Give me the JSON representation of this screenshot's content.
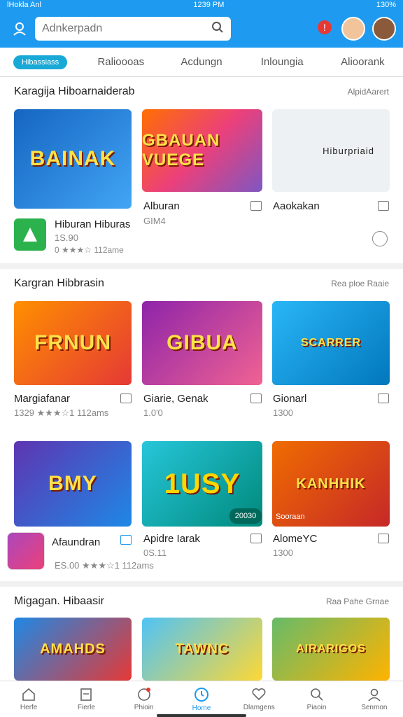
{
  "status": {
    "carrier": "lHokla Anl",
    "time": "1239 PM",
    "battery": "130%"
  },
  "search": {
    "placeholder": "Adnkerpadn"
  },
  "tabs": [
    "Hibassiass",
    "Ralioooas",
    "Acdungn",
    "Inloungia",
    "Alioorank"
  ],
  "sections": [
    {
      "title": "Karagija Hiboarnaiderab",
      "more": "AlpidAarert",
      "cards": [
        {
          "art": "BAINAK",
          "title": "",
          "sub": ""
        },
        {
          "art": "GBAUAN VUEGE",
          "title": "Alburan",
          "sub": "GIM4"
        },
        {
          "art": "Hiburpriaid",
          "title": "Aaokakan",
          "sub": ""
        }
      ],
      "app": {
        "title": "Hiburan Hiburas",
        "sub": "1S.90",
        "rating": "0 ★★★☆ 112ame"
      }
    },
    {
      "title": "Kargran Hibbrasin",
      "more": "Rea ploe Raaie",
      "cards": [
        {
          "art": "FRNUN",
          "title": "Margiafanar",
          "sub": "1329 ★★★☆1 112ams"
        },
        {
          "art": "GIBUA",
          "title": "Giarie, Genak",
          "sub": "1.0'0"
        },
        {
          "art": "SCARRER",
          "title": "Gionarl",
          "sub": "1300"
        }
      ]
    },
    {
      "title": "",
      "more": "",
      "cards": [
        {
          "art": "BMY",
          "title": "Afaundran",
          "sub": "ES.00 ★★★☆1 112ams"
        },
        {
          "art": "1USY",
          "title": "Apidre Iarak",
          "sub": "0S.11",
          "badge": "20030"
        },
        {
          "art": "KANHHIK",
          "title": "AlomeYC",
          "sub": "1300",
          "badge": "Sooraan"
        }
      ]
    },
    {
      "title": "Migagan. Hibaasir",
      "more": "Raa Pahe Grnae",
      "cards": [
        {
          "art": "AMAHDS",
          "title": "",
          "sub": ""
        },
        {
          "art": "TAWNC",
          "title": "",
          "sub": ""
        },
        {
          "art": "AIRARIGOS",
          "title": "",
          "sub": ""
        }
      ]
    }
  ],
  "nav": [
    "Herfe",
    "Fierle",
    "Phioin",
    "Home",
    "Dlamgens",
    "Piaoin",
    "Senmon"
  ],
  "colors": {
    "accent": "#1e9bf0",
    "tab_active": "#19a9d6"
  }
}
